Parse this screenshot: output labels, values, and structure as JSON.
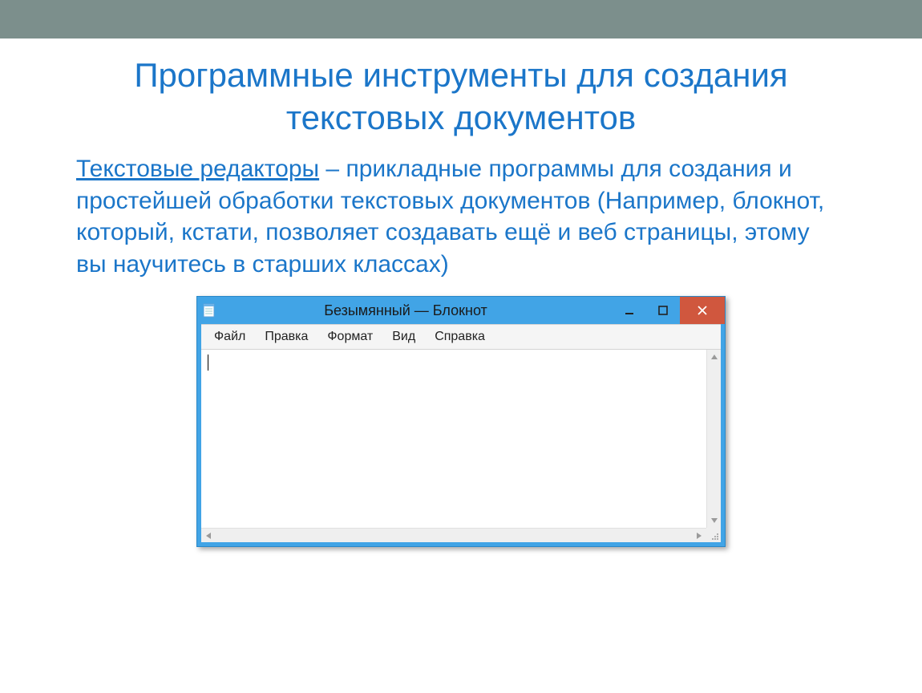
{
  "slide": {
    "title": "Программные инструменты для создания текстовых документов",
    "term": "Текстовые редакторы",
    "definition": " – прикладные программы для создания и простейшей обработки текстовых документов (Например, блокнот, который, кстати, позволяет создавать ещё и веб страницы, этому вы научитесь в старших классах)"
  },
  "notepad": {
    "title": "Безымянный — Блокнот",
    "menu": {
      "file": "Файл",
      "edit": "Правка",
      "format": "Формат",
      "view": "Вид",
      "help": "Справка"
    }
  }
}
